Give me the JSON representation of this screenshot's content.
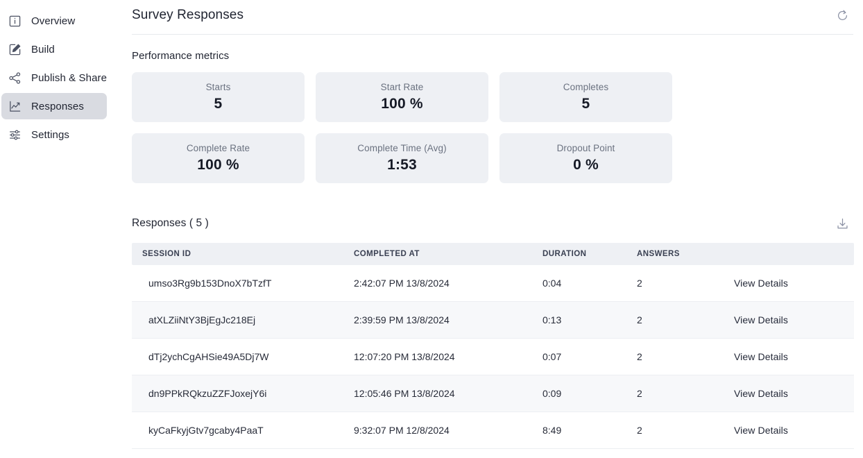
{
  "sidebar": {
    "items": [
      {
        "label": "Overview",
        "icon": "info-icon",
        "active": false
      },
      {
        "label": "Build",
        "icon": "pencil-icon",
        "active": false
      },
      {
        "label": "Publish & Share",
        "icon": "share-icon",
        "active": false
      },
      {
        "label": "Responses",
        "icon": "line-chart-icon",
        "active": true
      },
      {
        "label": "Settings",
        "icon": "sliders-icon",
        "active": false
      }
    ]
  },
  "header": {
    "title": "Survey Responses",
    "refresh_icon": "refresh-icon"
  },
  "performance": {
    "section_title": "Performance metrics",
    "cards": [
      {
        "label": "Starts",
        "value": "5"
      },
      {
        "label": "Start Rate",
        "value": "100 %"
      },
      {
        "label": "Completes",
        "value": "5"
      },
      {
        "label": "Complete Rate",
        "value": "100 %"
      },
      {
        "label": "Complete Time (Avg)",
        "value": "1:53"
      },
      {
        "label": "Dropout Point",
        "value": "0 %"
      }
    ]
  },
  "responses": {
    "title": "Responses ( 5 )",
    "download_icon": "download-icon",
    "columns": [
      "SESSION ID",
      "COMPLETED AT",
      "DURATION",
      "ANSWERS",
      ""
    ],
    "action_label": "View Details",
    "rows": [
      {
        "session_id": "umso3Rg9b153DnoX7bTzfT",
        "completed_at": "2:42:07 PM 13/8/2024",
        "duration": "0:04",
        "answers": "2",
        "action": "View Details"
      },
      {
        "session_id": "atXLZiiNtY3BjEgJc218Ej",
        "completed_at": "2:39:59 PM 13/8/2024",
        "duration": "0:13",
        "answers": "2",
        "action": "View Details"
      },
      {
        "session_id": "dTj2ychCgAHSie49A5Dj7W",
        "completed_at": "12:07:20 PM 13/8/2024",
        "duration": "0:07",
        "answers": "2",
        "action": "View Details"
      },
      {
        "session_id": "dn9PPkRQkzuZZFJoxejY6i",
        "completed_at": "12:05:46 PM 13/8/2024",
        "duration": "0:09",
        "answers": "2",
        "action": "View Details"
      },
      {
        "session_id": "kyCaFkyjGtv7gcaby4PaaT",
        "completed_at": "9:32:07 PM 12/8/2024",
        "duration": "8:49",
        "answers": "2",
        "action": "View Details"
      }
    ]
  },
  "colors": {
    "card_background": "#eef0f4",
    "active_nav": "#d9dbe1",
    "row_alt": "#f7f8fa",
    "text_primary": "#1f2330",
    "text_muted": "#6b7280"
  }
}
